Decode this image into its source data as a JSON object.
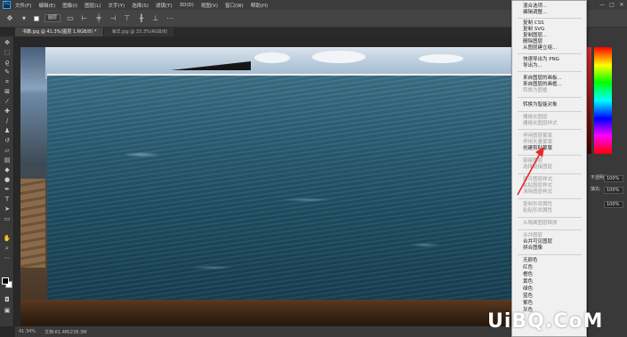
{
  "app": {
    "logo": "Ps",
    "logo_icon": "photoshop-logo-icon"
  },
  "menubar": {
    "items": [
      "文件(F)",
      "编辑(E)",
      "图像(I)",
      "图层(L)",
      "文字(Y)",
      "选择(S)",
      "滤镜(T)",
      "3D(D)",
      "视图(V)",
      "窗口(W)",
      "帮助(H)"
    ]
  },
  "window_controls": {
    "minimize": "—",
    "maximize": "□",
    "close": "✕"
  },
  "options_bar": {
    "auto_select_label": "图层",
    "checkbox_label": "",
    "icons": [
      "move-tool-icon",
      "align-icon",
      "more-icon"
    ]
  },
  "tabs": [
    {
      "label": "书籍.jpg @ 41.3%(图层 1,RGB/8) *",
      "active": true
    },
    {
      "label": "海洋.jpg @ 33.3%(RGB/8)",
      "active": false
    }
  ],
  "context_menu": {
    "items": [
      {
        "label": "混合选项...",
        "enabled": true
      },
      {
        "label": "编辑调整...",
        "enabled": true
      },
      {
        "label": "复制 CSS",
        "enabled": true
      },
      {
        "label": "复制 SVG",
        "enabled": true
      },
      {
        "label": "复制图层...",
        "enabled": true
      },
      {
        "label": "删除图层",
        "enabled": true
      },
      {
        "label": "从图层建立组...",
        "enabled": true
      },
      {
        "label": "快速导出为 PNG",
        "enabled": true
      },
      {
        "label": "导出为...",
        "enabled": true
      },
      {
        "label": "来自图层的画板...",
        "enabled": true
      },
      {
        "label": "来自图层的画框...",
        "enabled": true
      },
      {
        "label": "转换为图框",
        "enabled": false
      },
      {
        "label": "转换为智能对象",
        "enabled": true
      },
      {
        "label": "栅格化图层",
        "enabled": false
      },
      {
        "label": "栅格化图层样式",
        "enabled": false
      },
      {
        "label": "停用图层蒙版",
        "enabled": false
      },
      {
        "label": "停用矢量蒙版",
        "enabled": false
      },
      {
        "label": "创建剪贴蒙版",
        "enabled": true
      },
      {
        "label": "链接图层",
        "enabled": false
      },
      {
        "label": "选择链接图层",
        "enabled": false
      },
      {
        "label": "拷贝图层样式",
        "enabled": false
      },
      {
        "label": "粘贴图层样式",
        "enabled": false
      },
      {
        "label": "清除图层样式",
        "enabled": false
      },
      {
        "label": "复制形状属性",
        "enabled": false
      },
      {
        "label": "粘贴形状属性",
        "enabled": false
      },
      {
        "label": "从隔离图层释放",
        "enabled": false
      },
      {
        "label": "合并图层",
        "enabled": false
      },
      {
        "label": "合并可见图层",
        "enabled": true
      },
      {
        "label": "拼合图像",
        "enabled": true
      },
      {
        "label": "无颜色",
        "enabled": true
      },
      {
        "label": "红色",
        "enabled": true
      },
      {
        "label": "橙色",
        "enabled": true
      },
      {
        "label": "黄色",
        "enabled": true
      },
      {
        "label": "绿色",
        "enabled": true
      },
      {
        "label": "蓝色",
        "enabled": true
      },
      {
        "label": "紫色",
        "enabled": true
      },
      {
        "label": "灰色",
        "enabled": true
      }
    ]
  },
  "right_panel": {
    "opacity_label": "不透明度:",
    "opacity_value": "100%",
    "fill_label": "填充:",
    "fill_value": "100%",
    "row3_value": "100%"
  },
  "status_bar": {
    "zoom": "41.34%",
    "doc_info": "文档:61.4M/238.3M"
  },
  "annotation": {
    "arrow_color": "#e8262b"
  },
  "watermark": {
    "text": "UiBQ.CoM",
    "sub": ""
  },
  "colors": {
    "accent": "#31a8ff",
    "menu_bg": "#f0f0f0",
    "panel_bg": "#393939"
  }
}
